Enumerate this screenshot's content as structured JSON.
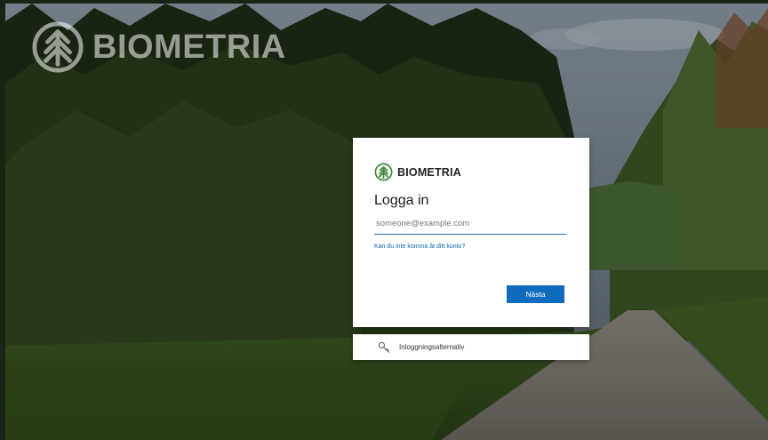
{
  "background_logo": {
    "text": "BIOMETRIA"
  },
  "card": {
    "logo_text": "BIOMETRIA",
    "title": "Logga in",
    "email_placeholder": "someone@example.com",
    "cant_access_link": "Kan du inte komma åt ditt konto?",
    "next_button": "Nästa"
  },
  "sign_in_options": {
    "label": "Inloggningsalternativ",
    "icon": "key-icon"
  },
  "colors": {
    "accent": "#0f6cbd",
    "brand_green": "#3c8a3a"
  }
}
